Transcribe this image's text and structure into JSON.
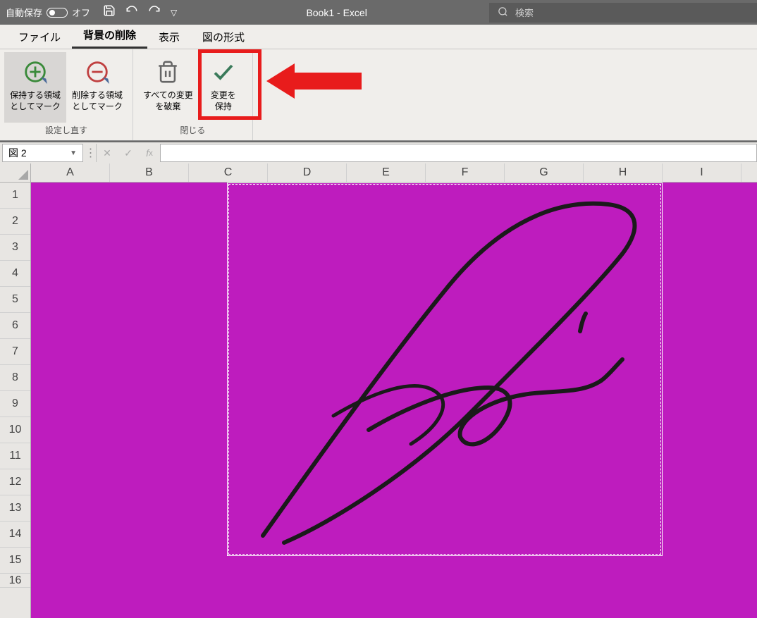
{
  "titlebar": {
    "autosave_label": "自動保存",
    "autosave_state": "オフ",
    "title": "Book1  -  Excel",
    "search_placeholder": "検索"
  },
  "tabs": {
    "file": "ファイル",
    "bg_remove": "背景の削除",
    "view": "表示",
    "picture_format": "図の形式"
  },
  "ribbon": {
    "mark_keep": "保持する領域\nとしてマーク",
    "mark_remove": "削除する領域\nとしてマーク",
    "discard_all": "すべての変更\nを破棄",
    "keep_changes": "変更を\n保持",
    "group_refine": "設定し直す",
    "group_close": "閉じる"
  },
  "namebox": {
    "value": "図 2"
  },
  "columns": [
    "A",
    "B",
    "C",
    "D",
    "E",
    "F",
    "G",
    "H",
    "I"
  ],
  "rows": [
    "1",
    "2",
    "3",
    "4",
    "5",
    "6",
    "7",
    "8",
    "9",
    "10",
    "11",
    "12",
    "13",
    "14",
    "15",
    "16"
  ]
}
